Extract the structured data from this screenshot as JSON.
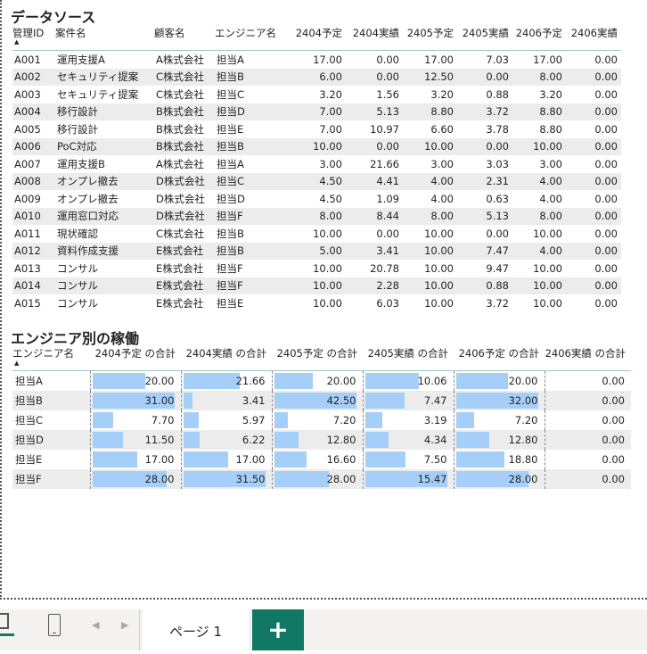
{
  "table1": {
    "title": "データソース",
    "headers": [
      "管理ID",
      "案件名",
      "顧客名",
      "エンジニア名",
      "2404予定",
      "2404実績",
      "2405予定",
      "2405実績",
      "2406予定",
      "2406実績"
    ],
    "rows": [
      [
        "A001",
        "運用支援A",
        "A株式会社",
        "担当A",
        "17.00",
        "0.00",
        "17.00",
        "7.03",
        "17.00",
        "0.00"
      ],
      [
        "A002",
        "セキュリティ提案",
        "C株式会社",
        "担当B",
        "6.00",
        "0.00",
        "12.50",
        "0.00",
        "8.00",
        "0.00"
      ],
      [
        "A003",
        "セキュリティ提案",
        "C株式会社",
        "担当C",
        "3.20",
        "1.56",
        "3.20",
        "0.88",
        "3.20",
        "0.00"
      ],
      [
        "A004",
        "移行設計",
        "B株式会社",
        "担当D",
        "7.00",
        "5.13",
        "8.80",
        "3.72",
        "8.80",
        "0.00"
      ],
      [
        "A005",
        "移行設計",
        "B株式会社",
        "担当E",
        "7.00",
        "10.97",
        "6.60",
        "3.78",
        "8.80",
        "0.00"
      ],
      [
        "A006",
        "PoC対応",
        "B株式会社",
        "担当B",
        "10.00",
        "0.00",
        "10.00",
        "0.00",
        "10.00",
        "0.00"
      ],
      [
        "A007",
        "運用支援B",
        "A株式会社",
        "担当A",
        "3.00",
        "21.66",
        "3.00",
        "3.03",
        "3.00",
        "0.00"
      ],
      [
        "A008",
        "オンプレ撤去",
        "D株式会社",
        "担当C",
        "4.50",
        "4.41",
        "4.00",
        "2.31",
        "4.00",
        "0.00"
      ],
      [
        "A009",
        "オンプレ撤去",
        "D株式会社",
        "担当D",
        "4.50",
        "1.09",
        "4.00",
        "0.63",
        "4.00",
        "0.00"
      ],
      [
        "A010",
        "運用窓口対応",
        "D株式会社",
        "担当F",
        "8.00",
        "8.44",
        "8.00",
        "5.13",
        "8.00",
        "0.00"
      ],
      [
        "A011",
        "現状確認",
        "C株式会社",
        "担当B",
        "10.00",
        "0.00",
        "10.00",
        "0.00",
        "10.00",
        "0.00"
      ],
      [
        "A012",
        "資料作成支援",
        "E株式会社",
        "担当B",
        "5.00",
        "3.41",
        "10.00",
        "7.47",
        "4.00",
        "0.00"
      ],
      [
        "A013",
        "コンサル",
        "E株式会社",
        "担当F",
        "10.00",
        "20.78",
        "10.00",
        "9.47",
        "10.00",
        "0.00"
      ],
      [
        "A014",
        "コンサル",
        "E株式会社",
        "担当F",
        "10.00",
        "2.28",
        "10.00",
        "0.88",
        "10.00",
        "0.00"
      ],
      [
        "A015",
        "コンサル",
        "E株式会社",
        "担当E",
        "10.00",
        "6.03",
        "10.00",
        "3.72",
        "10.00",
        "0.00"
      ]
    ]
  },
  "table2": {
    "title": "エンジニア別の稼働",
    "headers": [
      "エンジニア名",
      "2404予定 の合計",
      "2404実績 の合計",
      "2405予定 の合計",
      "2405実績 の合計",
      "2406予定 の合計",
      "2406実績 の合計"
    ],
    "rows": [
      [
        "担当A",
        "20.00",
        "21.66",
        "20.00",
        "10.06",
        "20.00",
        "0.00"
      ],
      [
        "担当B",
        "31.00",
        "3.41",
        "42.50",
        "7.47",
        "32.00",
        "0.00"
      ],
      [
        "担当C",
        "7.70",
        "5.97",
        "7.20",
        "3.19",
        "7.20",
        "0.00"
      ],
      [
        "担当D",
        "11.50",
        "6.22",
        "12.80",
        "4.34",
        "12.80",
        "0.00"
      ],
      [
        "担当E",
        "17.00",
        "17.00",
        "16.60",
        "7.50",
        "18.80",
        "0.00"
      ],
      [
        "担当F",
        "28.00",
        "31.50",
        "28.00",
        "15.47",
        "28.00",
        "0.00"
      ]
    ],
    "bar_color": "#a5cff8"
  },
  "footer": {
    "page_tab": "ページ 1",
    "add_label": "+",
    "accent": "#117865",
    "icons": [
      "desktop-layout-icon",
      "mobile-layout-icon",
      "prev-page-icon",
      "next-page-icon"
    ]
  }
}
